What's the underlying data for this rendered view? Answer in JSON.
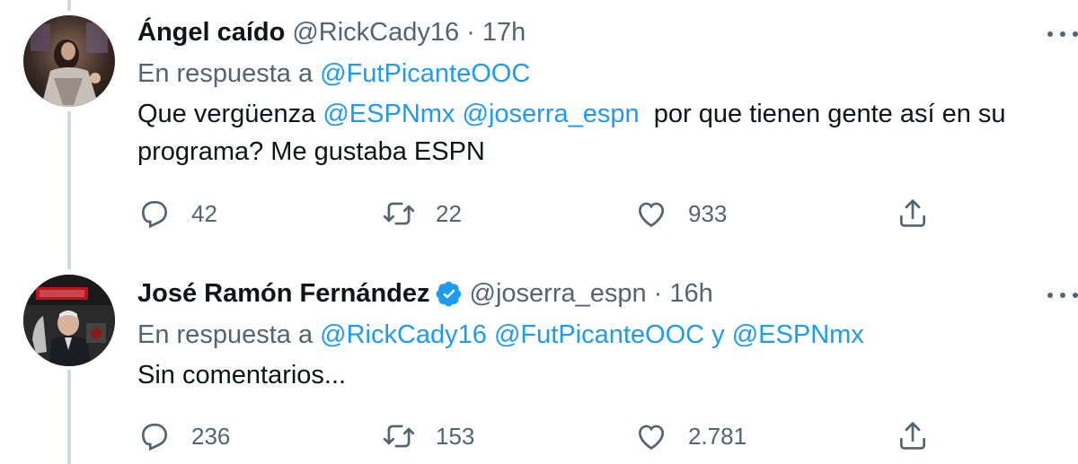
{
  "tweets": [
    {
      "name": "Ángel caído",
      "handle": "@RickCady16",
      "separator": "·",
      "time": "17h",
      "verified": false,
      "reply_prefix": "En respuesta a",
      "reply_mentions": [
        "@FutPicanteOOC"
      ],
      "reply_joiner": "",
      "body_parts": {
        "pre": "Que vergüenza ",
        "mention1": "@ESPNmx",
        "mid": " ",
        "mention2": "@joserra_espn",
        "post": "  por que tienen gente así en su programa? Me gustaba ESPN"
      },
      "stats": {
        "replies": "42",
        "retweets": "22",
        "likes": "933"
      }
    },
    {
      "name": "José Ramón Fernández",
      "handle": "@joserra_espn",
      "separator": "·",
      "time": "16h",
      "verified": true,
      "reply_prefix": "En respuesta a",
      "reply_mentions": [
        "@RickCady16",
        "@FutPicanteOOC",
        "@ESPNmx"
      ],
      "reply_joiner": "y",
      "body": "Sin comentarios...",
      "stats": {
        "replies": "236",
        "retweets": "153",
        "likes": "2.781"
      }
    }
  ],
  "icons": {
    "reply": "reply-icon",
    "retweet": "retweet-icon",
    "like": "heart-icon",
    "share": "share-icon",
    "more": "more-icon",
    "verified": "verified-badge-icon"
  },
  "colors": {
    "link": "#1d9bf0",
    "secondary": "#536471",
    "text": "#0f1419",
    "thread_line": "#cfd9de",
    "verified": "#1d9bf0"
  }
}
